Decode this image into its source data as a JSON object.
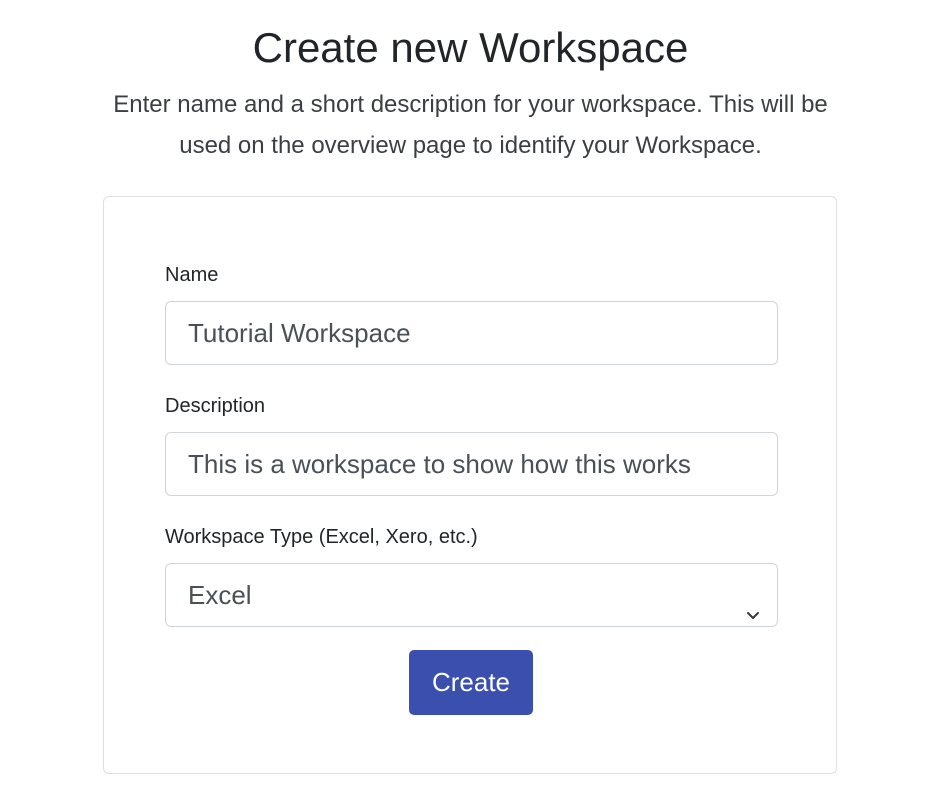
{
  "header": {
    "title": "Create new Workspace",
    "subtitle": "Enter name and a short description for your workspace. This will be used on the overview page to identify your Workspace."
  },
  "form": {
    "name": {
      "label": "Name",
      "value": "Tutorial Workspace"
    },
    "description": {
      "label": "Description",
      "value": "This is a workspace to show how this works"
    },
    "workspace_type": {
      "label": "Workspace Type (Excel, Xero, etc.)",
      "selected": "Excel"
    },
    "submit_label": "Create"
  },
  "colors": {
    "primary_button": "#3a4fae",
    "border": "#ced4da",
    "text": "#212529"
  },
  "icons": {
    "select_chevron": "chevron-down-icon"
  }
}
